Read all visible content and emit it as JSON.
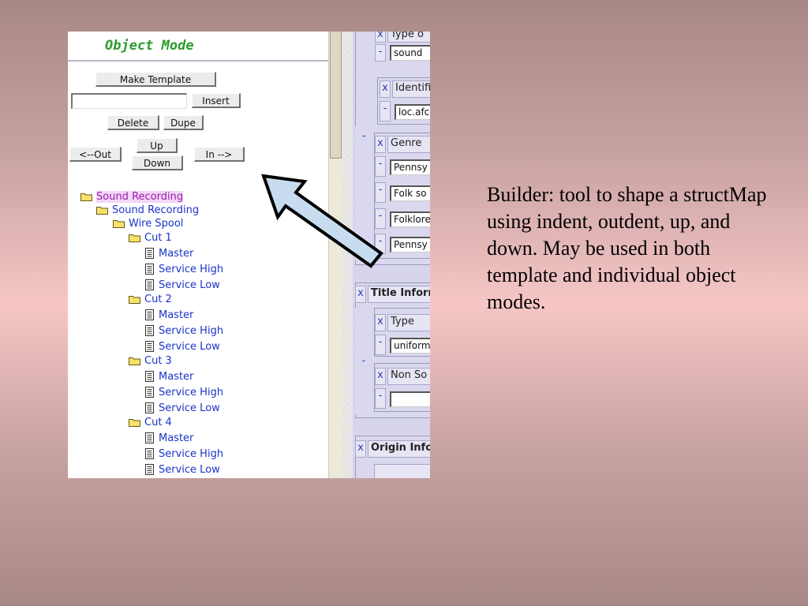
{
  "object_mode": {
    "title": "Object Mode",
    "buttons": {
      "make_template": "Make Template",
      "insert": "Insert",
      "delete": "Delete",
      "dupe": "Dupe",
      "up": "Up",
      "down": "Down",
      "out": "<--Out",
      "in": "In  -->"
    },
    "insert_input_value": ""
  },
  "tree": [
    {
      "label": "Sound Recording",
      "icon": "folder-icon",
      "selected": true
    },
    {
      "label": "Sound Recording",
      "icon": "folder-icon"
    },
    {
      "label": "Wire Spool",
      "icon": "folder-icon"
    },
    {
      "label": "Cut 1",
      "icon": "folder-icon"
    },
    {
      "label": "Master",
      "icon": "document-icon"
    },
    {
      "label": "Service High",
      "icon": "document-icon"
    },
    {
      "label": "Service Low",
      "icon": "document-icon"
    },
    {
      "label": "Cut 2",
      "icon": "folder-icon"
    },
    {
      "label": "Master",
      "icon": "document-icon"
    },
    {
      "label": "Service High",
      "icon": "document-icon"
    },
    {
      "label": "Service Low",
      "icon": "document-icon"
    },
    {
      "label": "Cut 3",
      "icon": "folder-icon"
    },
    {
      "label": "Master",
      "icon": "document-icon"
    },
    {
      "label": "Service High",
      "icon": "document-icon"
    },
    {
      "label": "Service Low",
      "icon": "document-icon"
    },
    {
      "label": "Cut 4",
      "icon": "folder-icon"
    },
    {
      "label": "Master",
      "icon": "document-icon"
    },
    {
      "label": "Service High",
      "icon": "document-icon"
    },
    {
      "label": "Service Low",
      "icon": "document-icon"
    }
  ],
  "form": {
    "x": "x",
    "minus": "-",
    "type_label": "Type o",
    "type_value": "sound",
    "identifier_label": "Identifi",
    "identifier_value": "loc.afc",
    "genre_label": "Genre",
    "genre_values": [
      "Pennsy",
      "Folk so",
      "Folklore",
      "Pennsy"
    ],
    "title_info_label": "Title Inform",
    "title_type_label": "Type",
    "title_type_value": "uniform",
    "non_sort_label": "Non So",
    "non_sort_value": "",
    "origin_info_label": "Origin Info"
  },
  "caption": "Builder: tool to shape a structMap using indent, outdent, up, and down. May be used in both template and individual object modes."
}
